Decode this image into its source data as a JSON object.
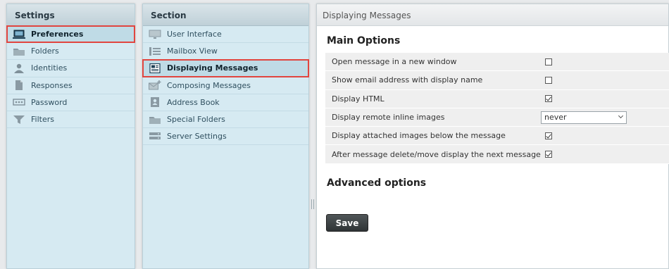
{
  "settings": {
    "title": "Settings",
    "items": [
      {
        "label": "Preferences",
        "icon": "preferences-icon",
        "selected": true
      },
      {
        "label": "Folders",
        "icon": "folder-icon"
      },
      {
        "label": "Identities",
        "icon": "person-icon"
      },
      {
        "label": "Responses",
        "icon": "document-icon"
      },
      {
        "label": "Password",
        "icon": "password-icon"
      },
      {
        "label": "Filters",
        "icon": "filter-icon"
      }
    ]
  },
  "section": {
    "title": "Section",
    "items": [
      {
        "label": "User Interface",
        "icon": "monitor-icon"
      },
      {
        "label": "Mailbox View",
        "icon": "list-view-icon"
      },
      {
        "label": "Displaying Messages",
        "icon": "message-display-icon",
        "selected": true
      },
      {
        "label": "Composing Messages",
        "icon": "compose-mail-icon"
      },
      {
        "label": "Address Book",
        "icon": "address-book-icon"
      },
      {
        "label": "Special Folders",
        "icon": "folder-icon"
      },
      {
        "label": "Server Settings",
        "icon": "server-icon"
      }
    ]
  },
  "content": {
    "header": "Displaying Messages",
    "main_options_title": "Main Options",
    "options": [
      {
        "label": "Open message in a new window",
        "type": "checkbox",
        "checked": false
      },
      {
        "label": "Show email address with display name",
        "type": "checkbox",
        "checked": false
      },
      {
        "label": "Display HTML",
        "type": "checkbox",
        "checked": true
      },
      {
        "label": "Display remote inline images",
        "type": "select",
        "value": "never"
      },
      {
        "label": "Display attached images below the message",
        "type": "checkbox",
        "checked": true
      },
      {
        "label": "After message delete/move display the next message",
        "type": "checkbox",
        "checked": true
      }
    ],
    "advanced_title": "Advanced options",
    "save_label": "Save"
  },
  "colors": {
    "selection_outline": "#e1453f",
    "panel_background": "#d6eaf2",
    "save_button": "#3a3f41"
  }
}
